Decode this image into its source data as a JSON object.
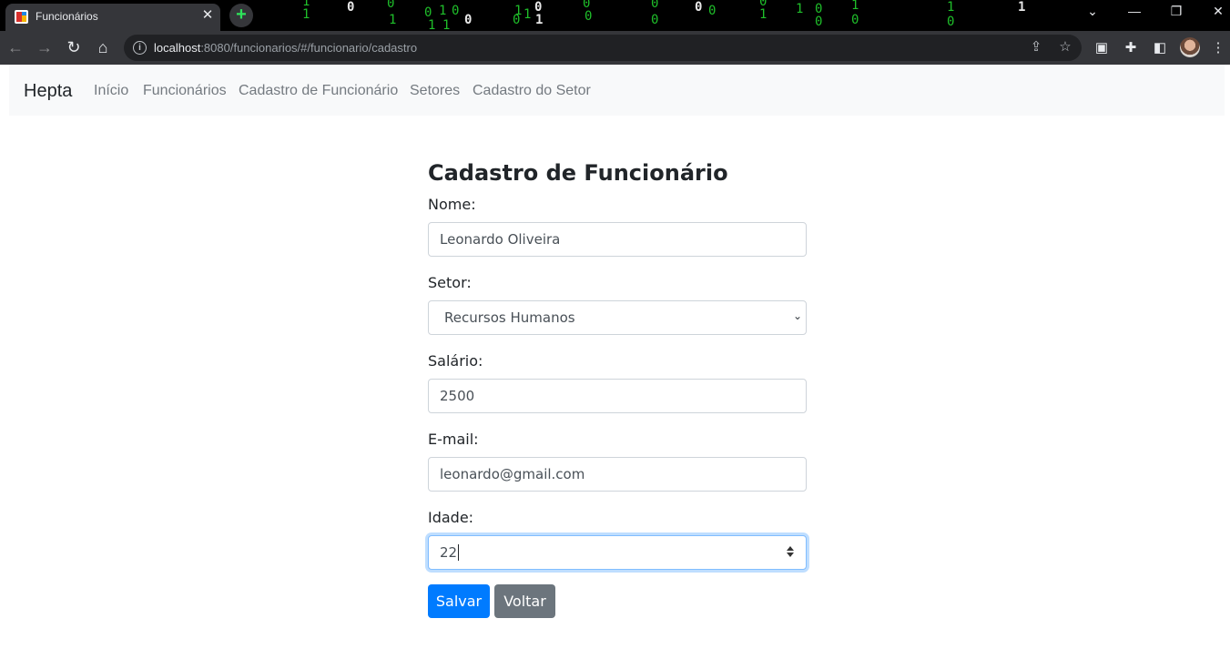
{
  "browser": {
    "tab_title": "Funcionários",
    "tab_close": "✕",
    "new_tab": "+",
    "url_host": "localhost",
    "url_rest": ":8080/funcionarios/#/funcionario/cadastro",
    "window_controls": {
      "tabsearch": "⌄",
      "minimize": "—",
      "restore": "❐",
      "close": "✕"
    },
    "nav_icons": {
      "back": "←",
      "forward": "→",
      "reload": "↻",
      "home": "⌂"
    }
  },
  "navbar": {
    "brand": "Hepta",
    "links": [
      "Início",
      "Funcionários",
      "Cadastro de Funcionário",
      "Setores",
      "Cadastro do Setor"
    ]
  },
  "form": {
    "title": "Cadastro de Funcionário",
    "nome_label": "Nome:",
    "nome_value": "Leonardo Oliveira",
    "setor_label": "Setor:",
    "setor_value": "Recursos Humanos",
    "salario_label": "Salário:",
    "salario_value": "2500",
    "email_label": "E-mail:",
    "email_value": "leonardo@gmail.com",
    "idade_label": "Idade:",
    "idade_value": "22"
  },
  "buttons": {
    "save": "Salvar",
    "back": "Voltar"
  },
  "colors": {
    "primary": "#007bff",
    "secondary": "#6c757d",
    "navbar_bg": "#f8f9fa",
    "focus_border": "#80bdff"
  }
}
